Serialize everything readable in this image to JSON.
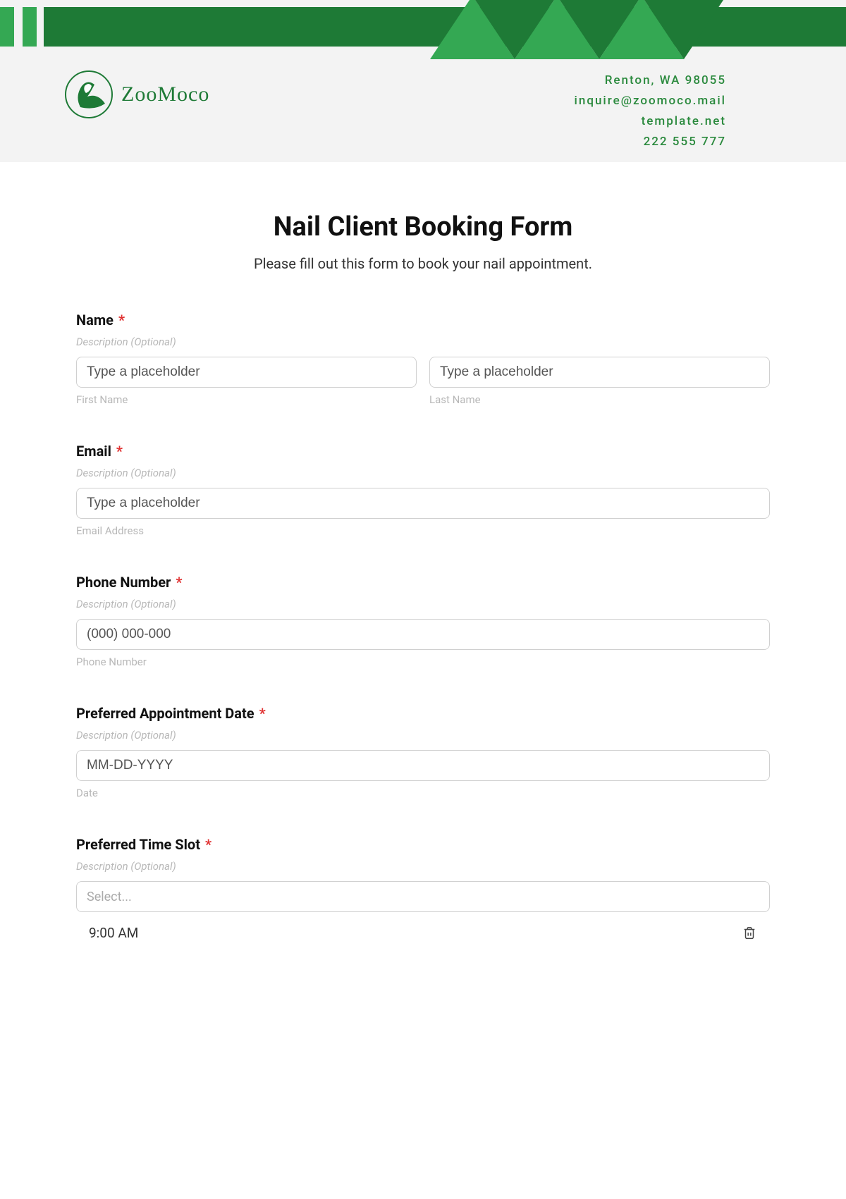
{
  "header": {
    "logo_name": "ZooMoco",
    "contact": {
      "line1": "Renton, WA 98055",
      "line2": "inquire@zoomoco.mail",
      "line3": "template.net",
      "line4": "222 555 777"
    }
  },
  "form": {
    "title": "Nail Client Booking Form",
    "subtitle": "Please fill out this form to book your nail appointment.",
    "required_mark": "*",
    "desc_placeholder": "Description (Optional)",
    "fields": {
      "name": {
        "label": "Name",
        "first_placeholder": "Type a placeholder",
        "first_sub": "First Name",
        "last_placeholder": "Type a placeholder",
        "last_sub": "Last Name"
      },
      "email": {
        "label": "Email",
        "placeholder": "Type a placeholder",
        "sub": "Email Address"
      },
      "phone": {
        "label": "Phone Number",
        "placeholder": "(000) 000-000",
        "sub": "Phone Number"
      },
      "date": {
        "label": "Preferred Appointment Date",
        "placeholder": "MM-DD-YYYY",
        "sub": "Date"
      },
      "time": {
        "label": "Preferred Time Slot",
        "select_placeholder": "Select...",
        "options": [
          "9:00 AM"
        ]
      }
    }
  }
}
